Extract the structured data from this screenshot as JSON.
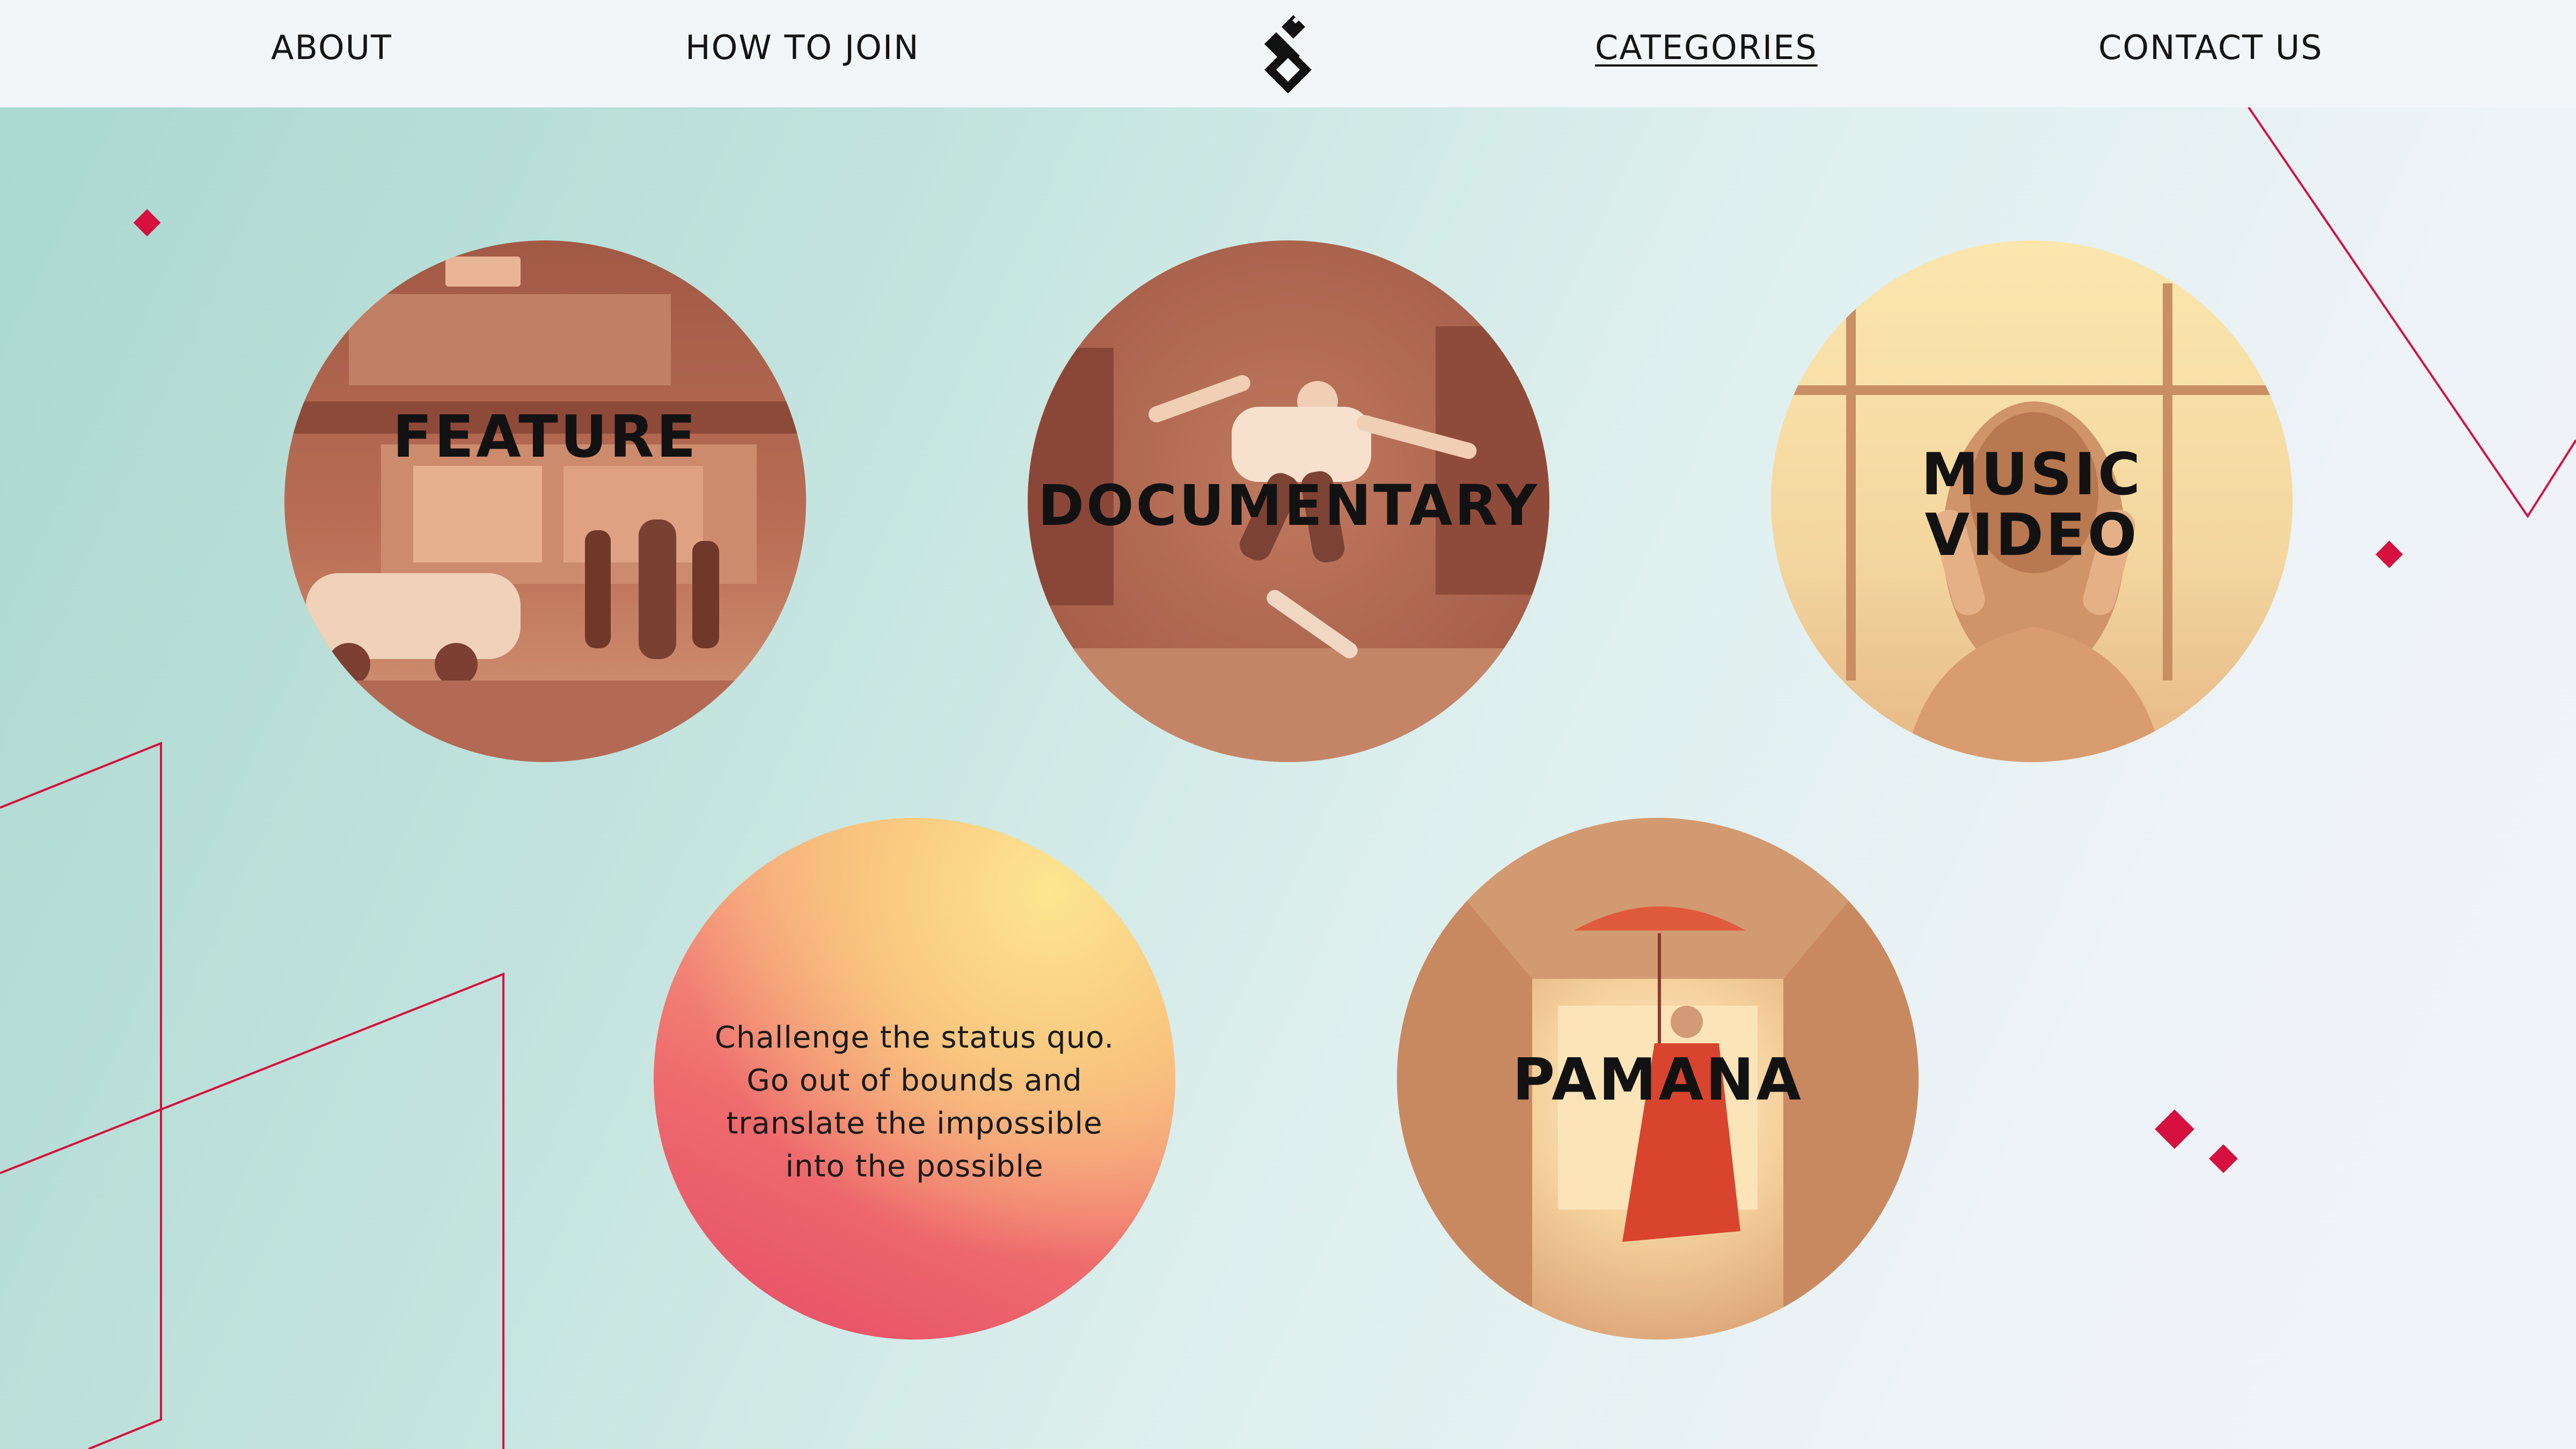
{
  "nav": {
    "about": "ABOUT",
    "how_to_join": "HOW TO JOIN",
    "categories": "CATEGORIES",
    "contact_us": "CONTACT US",
    "active": "categories",
    "logo_icon": "stacked-diamond-logo-icon"
  },
  "categories": [
    {
      "id": "feature",
      "title": "FEATURE",
      "scene": "night street crowd photo, sepia tint"
    },
    {
      "id": "documentary",
      "title": "DOCUMENTARY",
      "scene": "skateboarder mid-air photo, rust tint"
    },
    {
      "id": "music_video",
      "title_line1": "MUSIC",
      "title_line2": "VIDEO",
      "scene": "woman with headphones by window, cream tint"
    },
    {
      "id": "pamana",
      "title": "PAMANA",
      "scene": "monk with red umbrella in corridor, amber tint"
    }
  ],
  "tagline": {
    "line1": "Challenge the status quo.",
    "line2": "Go out of bounds and",
    "line3": "translate the impossible",
    "line4": "into the possible"
  },
  "colors": {
    "accent": "#d6103f",
    "nav_bg": "#f2f6f8",
    "text": "#141414",
    "bg_start": "#a9d8ce",
    "bg_end": "#f1f3fa"
  }
}
